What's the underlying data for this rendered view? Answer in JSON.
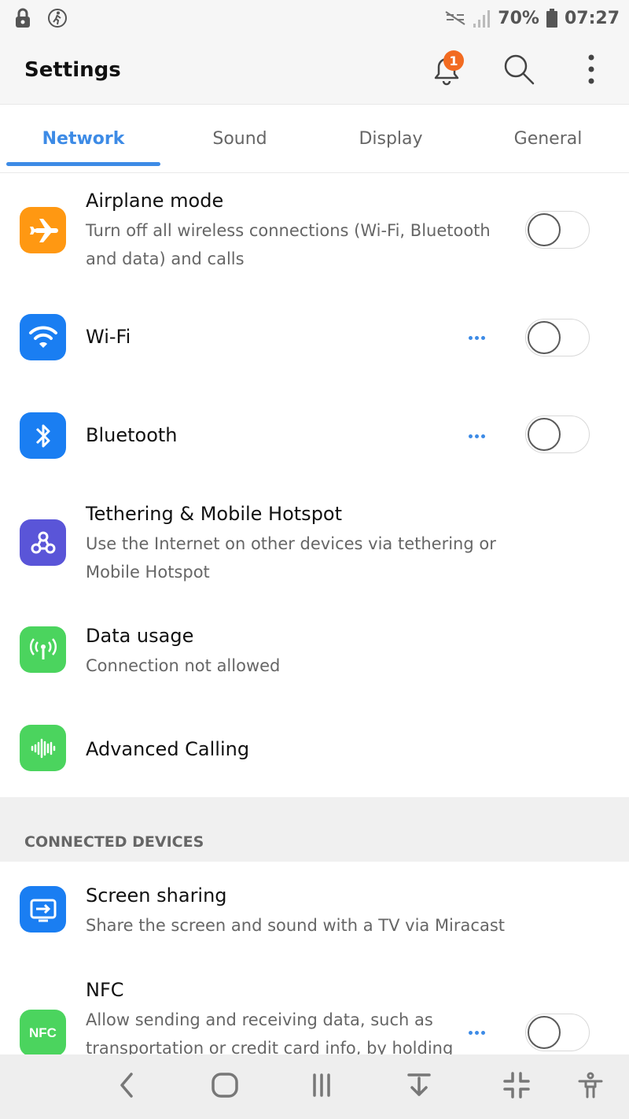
{
  "status_bar": {
    "battery": "70%",
    "time": "07:27"
  },
  "app_bar": {
    "title": "Settings",
    "notification_count": "1"
  },
  "tabs": [
    {
      "label": "Network",
      "active": true
    },
    {
      "label": "Sound",
      "active": false
    },
    {
      "label": "Display",
      "active": false
    },
    {
      "label": "General",
      "active": false
    }
  ],
  "network_items": [
    {
      "title": "Airplane mode",
      "subtitle": "Turn off all wireless connections (Wi-Fi, Bluetooth and data) and calls",
      "icon": "airplane-icon",
      "color": "#ff9812",
      "toggle": false
    },
    {
      "title": "Wi-Fi",
      "subtitle": "",
      "icon": "wifi-icon",
      "color": "#1a7ef2",
      "toggle": false
    },
    {
      "title": "Bluetooth",
      "subtitle": "",
      "icon": "bluetooth-icon",
      "color": "#1a7ef2",
      "toggle": false
    },
    {
      "title": "Tethering & Mobile Hotspot",
      "subtitle": "Use the Internet on other devices via tethering or Mobile Hotspot",
      "icon": "hotspot-icon",
      "color": "#5a55d8"
    },
    {
      "title": "Data usage",
      "subtitle": "Connection not allowed",
      "icon": "antenna-icon",
      "color": "#4bd45e"
    },
    {
      "title": "Advanced Calling",
      "subtitle": "",
      "icon": "waveform-icon",
      "color": "#4bd45e"
    }
  ],
  "connected_section": {
    "header": "CONNECTED DEVICES",
    "items": [
      {
        "title": "Screen sharing",
        "subtitle": "Share the screen and sound with a TV via Miracast",
        "icon": "screen-cast-icon",
        "color": "#1a7ef2"
      },
      {
        "title": "NFC",
        "subtitle": "Allow sending and receiving data, such as transportation or credit card info, by holding",
        "icon": "nfc-icon",
        "icon_text": "NFC",
        "color": "#4bd45e",
        "toggle": false
      }
    ]
  }
}
